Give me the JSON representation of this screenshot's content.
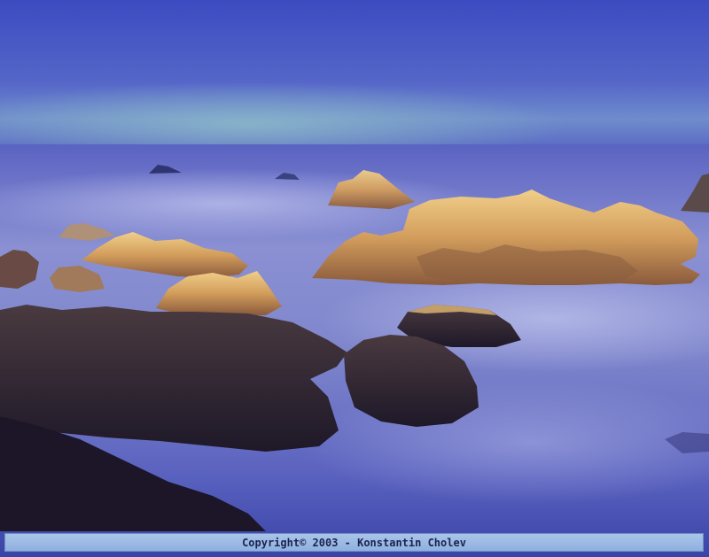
{
  "photo": {
    "subject": "rocky-seashore-long-exposure",
    "colors": {
      "sky_top": "#4a57c8",
      "sky_horizon": "#7fa2c8",
      "sea_mist": "#9aa6d8",
      "sea_deep": "#3b4aa8",
      "rock_lit": "#d8ad6a",
      "rock_shadow": "#2a2030"
    }
  },
  "caption": {
    "text": "Copyright© 2003 - Konstantin Cholev"
  }
}
